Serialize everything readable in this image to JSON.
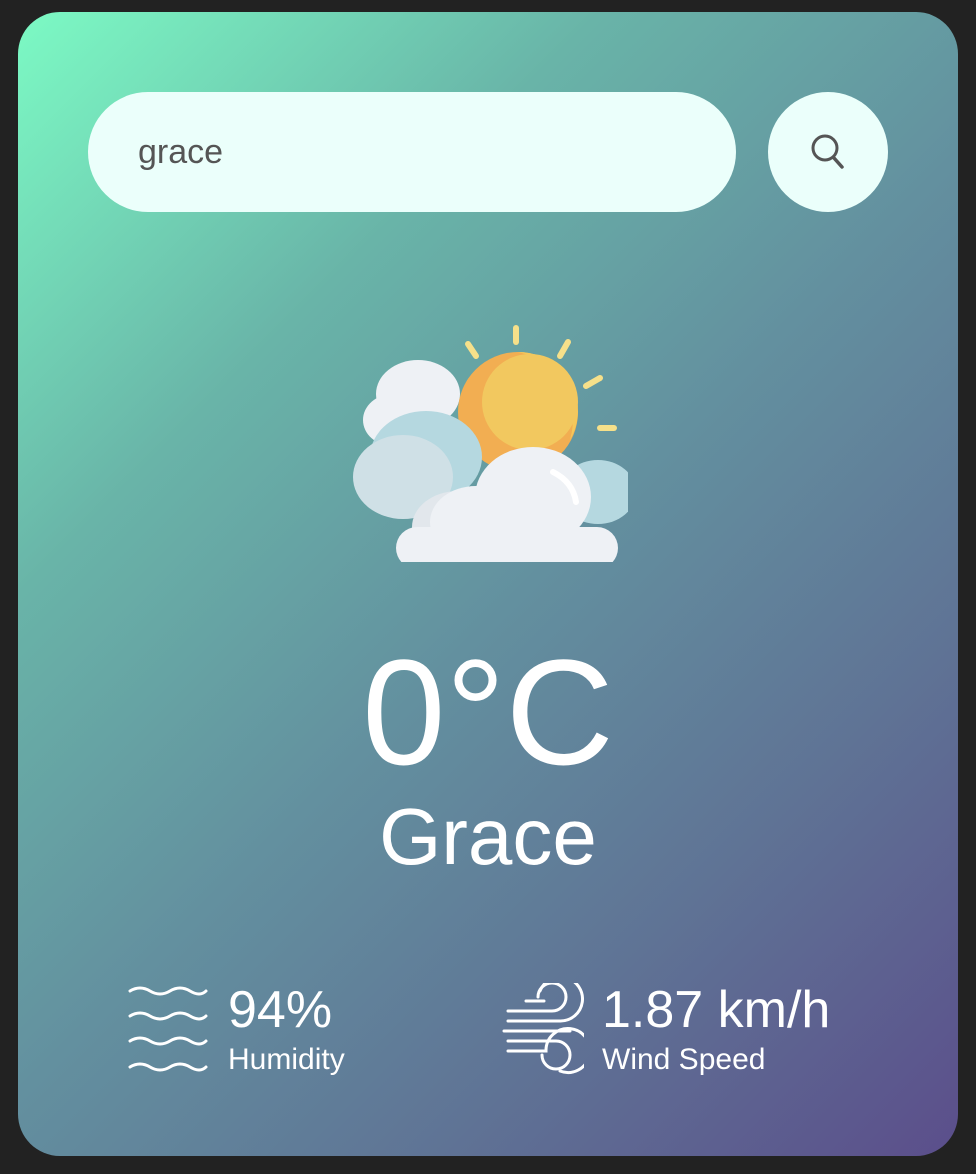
{
  "search": {
    "value": "grace",
    "button_icon": "search-icon"
  },
  "weather": {
    "icon": "partly-cloudy-icon",
    "temperature": "0°C",
    "city": "Grace"
  },
  "details": {
    "humidity": {
      "icon": "humidity-waves-icon",
      "value": "94%",
      "label": "Humidity"
    },
    "wind": {
      "icon": "wind-icon",
      "value": "1.87 km/h",
      "label": "Wind Speed"
    }
  },
  "colors": {
    "page_background": "#222222",
    "gradient_start": "#7cfac4",
    "gradient_end": "#5b4e8b",
    "input_background": "#ebfffb",
    "text": "#ffffff"
  }
}
